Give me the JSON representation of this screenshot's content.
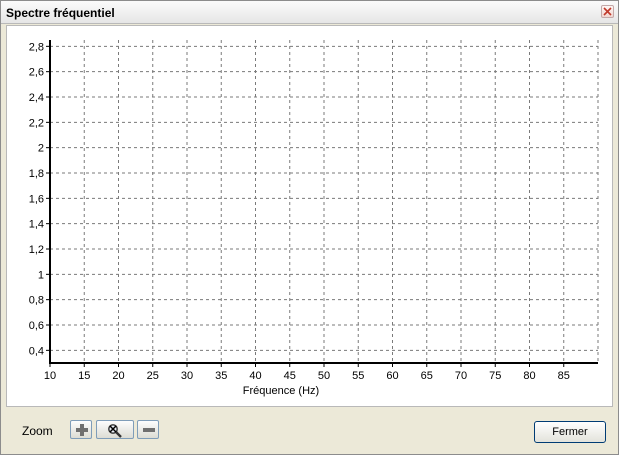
{
  "window": {
    "title": "Spectre fréquentiel"
  },
  "chart_data": {
    "type": "line",
    "title": "",
    "xlabel": "Fréquence (Hz)",
    "ylabel": "",
    "xlim": [
      10,
      90
    ],
    "ylim": [
      0.3,
      2.85
    ],
    "x_ticks": [
      "10",
      "15",
      "20",
      "25",
      "30",
      "35",
      "40",
      "45",
      "50",
      "55",
      "60",
      "65",
      "70",
      "75",
      "80",
      "85"
    ],
    "y_ticks": [
      "0,4",
      "0,6",
      "0,8",
      "1",
      "1,2",
      "1,4",
      "1,6",
      "1,8",
      "2",
      "2,2",
      "2,4",
      "2,6",
      "2,8"
    ],
    "grid": true,
    "series": []
  },
  "toolbar": {
    "zoom_label": "Zoom",
    "zoom_in_icon": "plus-icon",
    "zoom_reset_icon": "magnifier-x-icon",
    "zoom_out_icon": "minus-icon",
    "close_label": "Fermer"
  }
}
